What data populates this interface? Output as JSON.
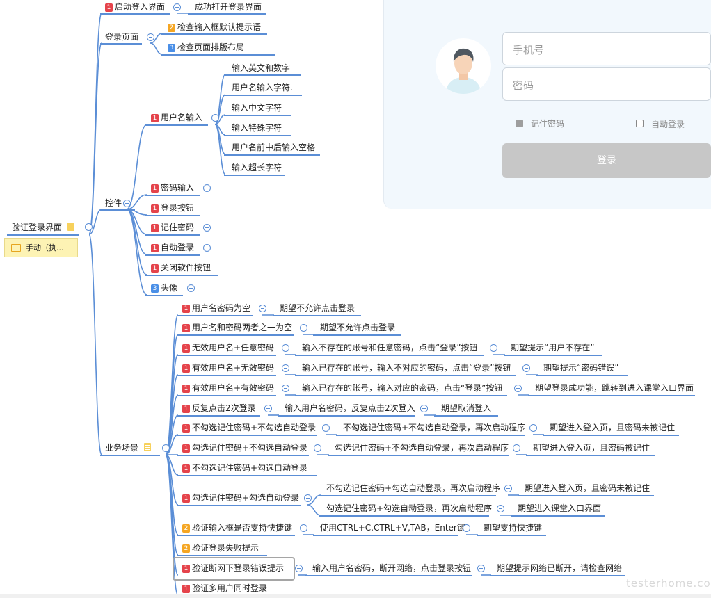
{
  "root": {
    "label": "验证登录界面",
    "note": "手动（执..."
  },
  "branches": {
    "launch": {
      "label": "启动登入界面",
      "priority": 1,
      "children": [
        "成功打开登录界面"
      ]
    },
    "login_page": {
      "label": "登录页面",
      "items": [
        {
          "label": "检查输入框默认提示语",
          "priority": 2
        },
        {
          "label": "检查页面排版布局",
          "priority": 3
        }
      ]
    },
    "controls": {
      "label": "控件",
      "items": [
        {
          "label": "用户名输入",
          "priority": 1,
          "children": [
            "输入英文和数字",
            "用户名输入字符.",
            "输入中文字符",
            "输入特殊字符",
            "用户名前中后输入空格",
            "输入超长字符"
          ]
        },
        {
          "label": "密码输入",
          "priority": 1,
          "collapsed": true
        },
        {
          "label": "登录按钮",
          "priority": 1
        },
        {
          "label": "记住密码",
          "priority": 1,
          "collapsed": true
        },
        {
          "label": "自动登录",
          "priority": 1,
          "collapsed": true
        },
        {
          "label": "关闭软件按钮",
          "priority": 1
        },
        {
          "label": "头像",
          "priority": 3,
          "collapsed": true
        }
      ]
    },
    "scenarios": {
      "label": "业务场景",
      "items": [
        {
          "label": "用户名密码为空",
          "priority": 1,
          "steps": [
            "期望不允许点击登录"
          ]
        },
        {
          "label": "用户名和密码两者之一为空",
          "priority": 1,
          "steps": [
            "期望不允许点击登录"
          ]
        },
        {
          "label": "无效用户名+任意密码",
          "priority": 1,
          "steps": [
            "输入不存在的账号和任意密码，点击“登录”按钮",
            "期望提示“用户不存在”"
          ]
        },
        {
          "label": "有效用户名+无效密码",
          "priority": 1,
          "steps": [
            "输入已存在的账号，输入不对应的密码，点击“登录”按钮",
            "期望提示“密码错误”"
          ]
        },
        {
          "label": "有效用户名+有效密码",
          "priority": 1,
          "steps": [
            "输入已存在的账号，输入对应的密码，点击“登录”按钮",
            "期望登录成功能，跳转到进入课堂入口界面"
          ]
        },
        {
          "label": "反复点击2次登录",
          "priority": 1,
          "steps": [
            "输入用户名密码，反复点击2次登入",
            "期望取消登入"
          ]
        },
        {
          "label": "不勾选记住密码+不勾选自动登录",
          "priority": 1,
          "steps": [
            "不勾选记住密码+不勾选自动登录，再次启动程序",
            "期望进入登入页，且密码未被记住"
          ]
        },
        {
          "label": "勾选记住密码+不勾选自动登录",
          "priority": 1,
          "steps": [
            "勾选记住密码+不勾选自动登录，再次启动程序",
            "期望进入登入页，且密码被记住"
          ]
        },
        {
          "label": "不勾选记住密码+勾选自动登录",
          "priority": 1,
          "steps": []
        },
        {
          "label": "勾选记住密码+勾选自动登录",
          "priority": 1,
          "branches": [
            [
              "不勾选记住密码+勾选自动登录，再次启动程序",
              "期望进入登入页，且密码未被记住"
            ],
            [
              "勾选记住密码+勾选自动登录，再次启动程序",
              "期望进入课堂入口界面"
            ]
          ]
        },
        {
          "label": "验证输入框是否支持快捷键",
          "priority": 2,
          "steps": [
            "使用CTRL+C,CTRL+V,TAB，Enter键",
            "期望支持快捷键"
          ]
        },
        {
          "label": "验证登录失败提示",
          "priority": 2,
          "steps": []
        },
        {
          "label": "验证断网下登录错误提示",
          "priority": 1,
          "steps": [
            "输入用户名密码，断开网络，点击登录按钮",
            "期望提示网络已断开，请检查网络"
          ]
        },
        {
          "label": "验证多用户同时登录",
          "priority": 1,
          "steps": []
        }
      ]
    }
  },
  "login_mock": {
    "phone_placeholder": "手机号",
    "password_placeholder": "密码",
    "remember_label": "记住密码",
    "auto_login_label": "自动登录",
    "login_button": "登录"
  },
  "watermark": "testerhome.com",
  "colors": {
    "line": "#5b8ed6",
    "p1": "#e5434b",
    "p2": "#f5a623",
    "p3": "#4a8fe7"
  }
}
